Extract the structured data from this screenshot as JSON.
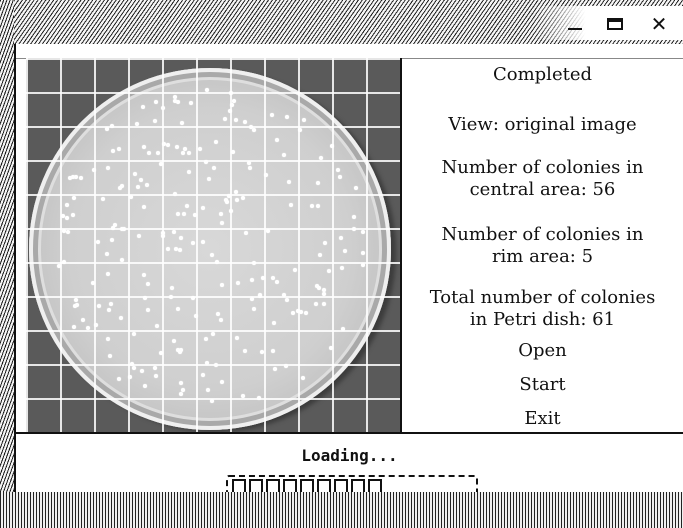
{
  "window": {
    "controls": [
      "minimize-icon",
      "maximize-icon",
      "close-icon"
    ],
    "close_glyph": "✕"
  },
  "info": {
    "status": "Completed",
    "view": "View: original image",
    "central_line1": "Number of colonies in",
    "central_line2": "central area: 56",
    "rim_line1": "Number of colonies in",
    "rim_line2": "rim area: 5",
    "total_line1": "Total number of colonies",
    "total_line2": "in Petri dish: 61"
  },
  "buttons": {
    "open": "Open",
    "start": "Start",
    "exit": "Exit"
  },
  "loading": {
    "label": "Loading...",
    "progress_blocks": 9,
    "progress_fraction": 0.64
  },
  "colors": {
    "text": "#111111",
    "background": "#ffffff",
    "grid": "#ffffff",
    "colony": "#ffffff"
  }
}
